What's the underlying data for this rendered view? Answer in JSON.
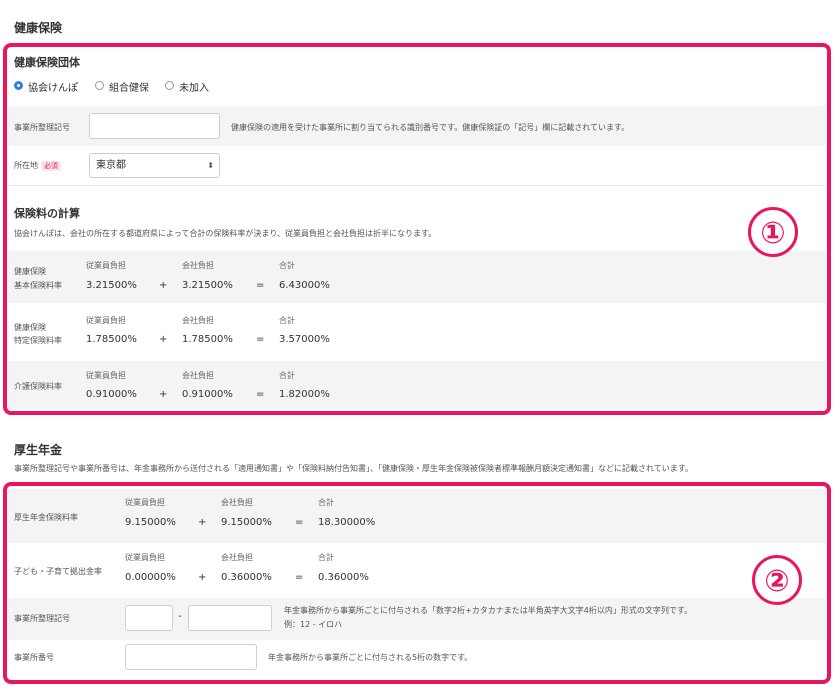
{
  "health": {
    "title": "健康保険",
    "group_title": "健康保険団体",
    "radios": [
      {
        "label": "協会けんぽ",
        "selected": true
      },
      {
        "label": "組合健保",
        "selected": false
      },
      {
        "label": "未加入",
        "selected": false
      }
    ],
    "office_code_label": "事業所整理記号",
    "office_code_value": "",
    "office_code_help": "健康保険の適用を受けた事業所に割り当てられる識別番号です。健康保険証の「記号」欄に記載されています。",
    "location_label": "所在地",
    "required_badge": "必須",
    "location_value": "東京都",
    "calc_title": "保険料の計算",
    "calc_desc": "協会けんぽは、会社の所在する都道府県によって合計の保険料率が決まり、従業員負担と会社負担は折半になります。",
    "rows": [
      {
        "label1": "健康保険",
        "label2": "基本保険料率",
        "employee": "3.21500%",
        "company": "3.21500%",
        "total": "6.43000%"
      },
      {
        "label1": "健康保険",
        "label2": "特定保険料率",
        "employee": "1.78500%",
        "company": "1.78500%",
        "total": "3.57000%"
      },
      {
        "label1": "介護保険料率",
        "label2": "",
        "employee": "0.91000%",
        "company": "0.91000%",
        "total": "1.82000%"
      }
    ]
  },
  "col_headers": {
    "employee": "従業員負担",
    "company": "会社負担",
    "total": "合計"
  },
  "ops": {
    "plus": "+",
    "equals": "=",
    "dash": "-"
  },
  "pension": {
    "title": "厚生年金",
    "desc": "事業所整理記号や事業所番号は、年金事務所から送付される「適用通知書」や「保険料納付告知書」、「健康保険・厚生年金保険被保険者標準報酬月額決定通知書」などに記載されています。",
    "rows": [
      {
        "label": "厚生年金保険料率",
        "employee": "9.15000%",
        "company": "9.15000%",
        "total": "18.30000%"
      },
      {
        "label": "子ども・子育て拠出金率",
        "employee": "0.00000%",
        "company": "0.36000%",
        "total": "0.36000%"
      }
    ],
    "office_code_label": "事業所整理記号",
    "office_code_help1": "年金事務所から事業所ごとに付与される「数字2桁+カタカナまたは半角英字大文字4桁以内」形式の文字列です。",
    "office_code_help2": "例：12 - イロハ",
    "office_no_label": "事業所番号",
    "office_no_help": "年金事務所から事業所ごとに付与される5桁の数字です。"
  },
  "badges": {
    "one": "①",
    "two": "②"
  },
  "colors": {
    "accent": "#e8175d",
    "radio": "#2f7de1"
  }
}
